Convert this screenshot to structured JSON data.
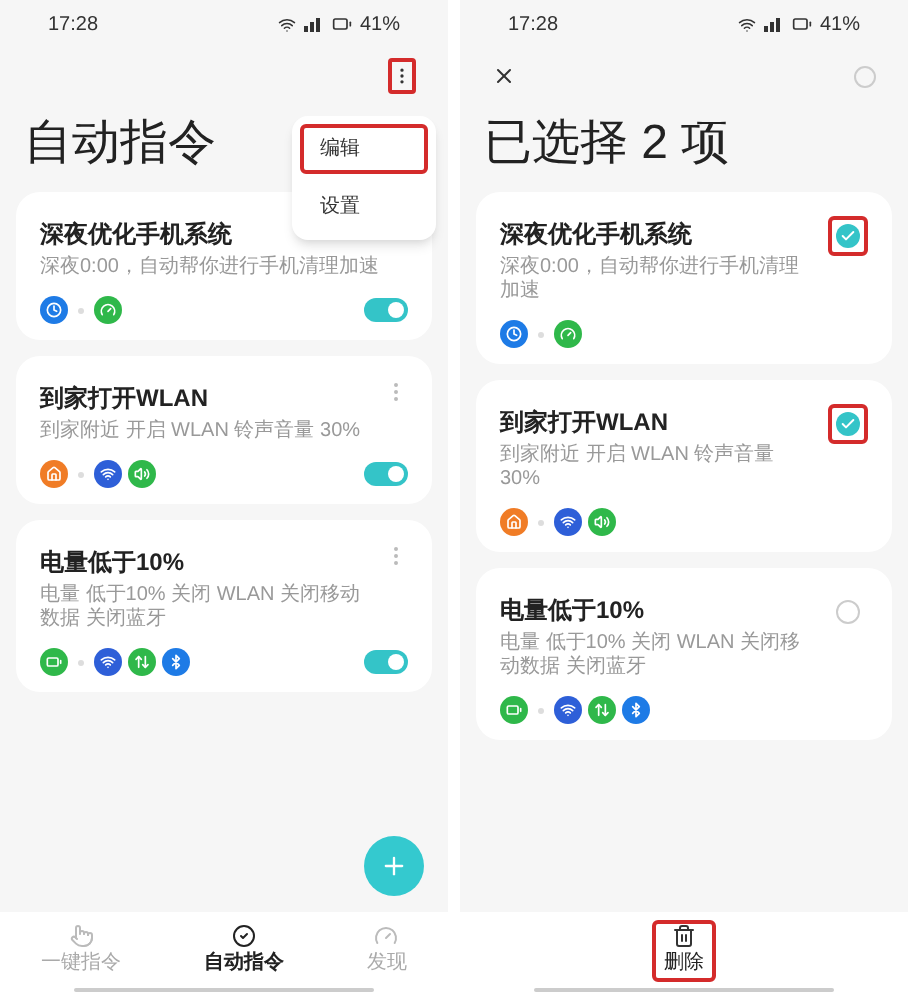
{
  "screens": [
    {
      "kind": "list",
      "status_bar": {
        "time": "17:28",
        "battery": "41%"
      },
      "more_button": {
        "highlighted": true
      },
      "title": "自动指令",
      "menu": {
        "items": [
          {
            "label": "编辑",
            "highlighted": true
          },
          {
            "label": "设置",
            "highlighted": false
          }
        ]
      },
      "cards": [
        {
          "title": "深夜优化手机系统",
          "subtitle": "深夜0:00，自动帮你进行手机清理加速",
          "on": true,
          "trigger": {
            "kind": "clock",
            "color": "#1e7be6"
          },
          "actions": [
            {
              "kind": "speed",
              "color": "#2fb84a"
            }
          ],
          "show_more": false
        },
        {
          "title": "到家打开WLAN",
          "subtitle": "到家附近  开启 WLAN 铃声音量 30%",
          "on": true,
          "trigger": {
            "kind": "home",
            "color": "#f07c26"
          },
          "actions": [
            {
              "kind": "wifi",
              "color": "#2e5fd8"
            },
            {
              "kind": "sound",
              "color": "#2fb84a"
            }
          ],
          "show_more": true
        },
        {
          "title": "电量低于10%",
          "subtitle": "电量 低于10% 关闭 WLAN 关闭移动数据 关闭蓝牙",
          "on": true,
          "trigger": {
            "kind": "battery",
            "color": "#2fb84a"
          },
          "actions": [
            {
              "kind": "wifi",
              "color": "#2e5fd8"
            },
            {
              "kind": "data",
              "color": "#2fb84a"
            },
            {
              "kind": "bluetooth",
              "color": "#1e7be6"
            }
          ],
          "show_more": true
        }
      ],
      "nav": [
        {
          "label": "一键指令",
          "selected": false
        },
        {
          "label": "自动指令",
          "selected": true
        },
        {
          "label": "发现",
          "selected": false
        }
      ]
    },
    {
      "kind": "select",
      "status_bar": {
        "time": "17:28",
        "battery": "41%"
      },
      "select_all": {
        "selected": false
      },
      "title": "已选择 2 项",
      "cards": [
        {
          "title": "深夜优化手机系统",
          "subtitle": "深夜0:00，自动帮你进行手机清理加速",
          "selected": true,
          "highlighted": true,
          "trigger": {
            "kind": "clock",
            "color": "#1e7be6"
          },
          "actions": [
            {
              "kind": "speed",
              "color": "#2fb84a"
            }
          ]
        },
        {
          "title": "到家打开WLAN",
          "subtitle": "到家附近  开启 WLAN 铃声音量 30%",
          "selected": true,
          "highlighted": true,
          "trigger": {
            "kind": "home",
            "color": "#f07c26"
          },
          "actions": [
            {
              "kind": "wifi",
              "color": "#2e5fd8"
            },
            {
              "kind": "sound",
              "color": "#2fb84a"
            }
          ]
        },
        {
          "title": "电量低于10%",
          "subtitle": "电量 低于10% 关闭 WLAN 关闭移动数据 关闭蓝牙",
          "selected": false,
          "highlighted": false,
          "trigger": {
            "kind": "battery",
            "color": "#2fb84a"
          },
          "actions": [
            {
              "kind": "wifi",
              "color": "#2e5fd8"
            },
            {
              "kind": "data",
              "color": "#2fb84a"
            },
            {
              "kind": "bluetooth",
              "color": "#1e7be6"
            }
          ]
        }
      ],
      "delete_button": {
        "label": "删除",
        "highlighted": true
      }
    }
  ]
}
